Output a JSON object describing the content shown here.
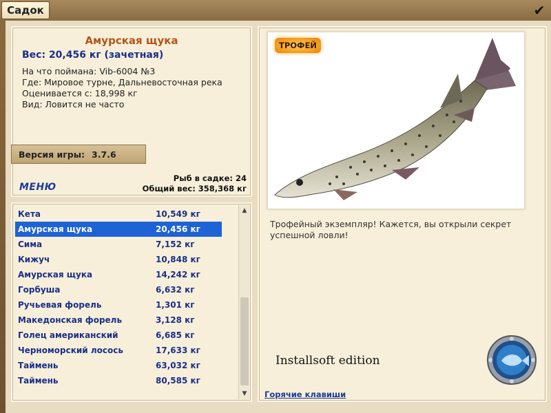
{
  "window": {
    "title": "Садок",
    "close_glyph": "✔",
    "close_icon": "checkmark-icon"
  },
  "fish": {
    "name": "Амурская щука",
    "weight_line": "Вес: 20,456 кг (зачетная)",
    "caught_on": "На что поймана: Vib-6004 №3",
    "location": "Где: Мировое турне, Дальневосточная река",
    "valued_from": "Оценивается с: 18,998 кг",
    "frequency": "Вид: Ловится не часто"
  },
  "version": {
    "label": "Версия игры:",
    "value": "3.7.6"
  },
  "menu_label": "МЕНЮ",
  "totals": {
    "count_line": "Рыб в садке: 24",
    "weight_line": "Общий вес: 358,368 кг"
  },
  "catch_list": {
    "selected_index": 1,
    "items": [
      {
        "name": "Кета",
        "weight": "10,549 кг"
      },
      {
        "name": "Амурская щука",
        "weight": "20,456 кг"
      },
      {
        "name": "Сима",
        "weight": "7,152 кг"
      },
      {
        "name": "Кижуч",
        "weight": "10,848 кг"
      },
      {
        "name": "Амурская щука",
        "weight": "14,242 кг"
      },
      {
        "name": "Горбуша",
        "weight": "6,632 кг"
      },
      {
        "name": "Ручьевая форель",
        "weight": "1,301 кг"
      },
      {
        "name": "Македонская форель",
        "weight": "3,128 кг"
      },
      {
        "name": "Голец американский",
        "weight": "6,685 кг"
      },
      {
        "name": "Черноморский лосось",
        "weight": "17,633 кг"
      },
      {
        "name": "Таймень",
        "weight": "63,032 кг"
      },
      {
        "name": "Таймень",
        "weight": "80,585 кг"
      }
    ]
  },
  "trophy": {
    "badge": "ТРОФЕЙ",
    "text": "Трофейный экземпляр! Кажется, вы открыли секрет успешной ловли!"
  },
  "watermark": "Installsoft edition",
  "hotkeys_label": "Горячие клавиши",
  "colors": {
    "accent_blue": "#1a2f8a",
    "selected_row": "#1e63d6",
    "fish_name": "#b3541a",
    "trophy_orange": "#f29a1a"
  },
  "icons": {
    "porthole": "porthole-fish-icon",
    "scroll_up": "scroll-up-arrow-icon",
    "scroll_down": "scroll-down-arrow-icon"
  }
}
